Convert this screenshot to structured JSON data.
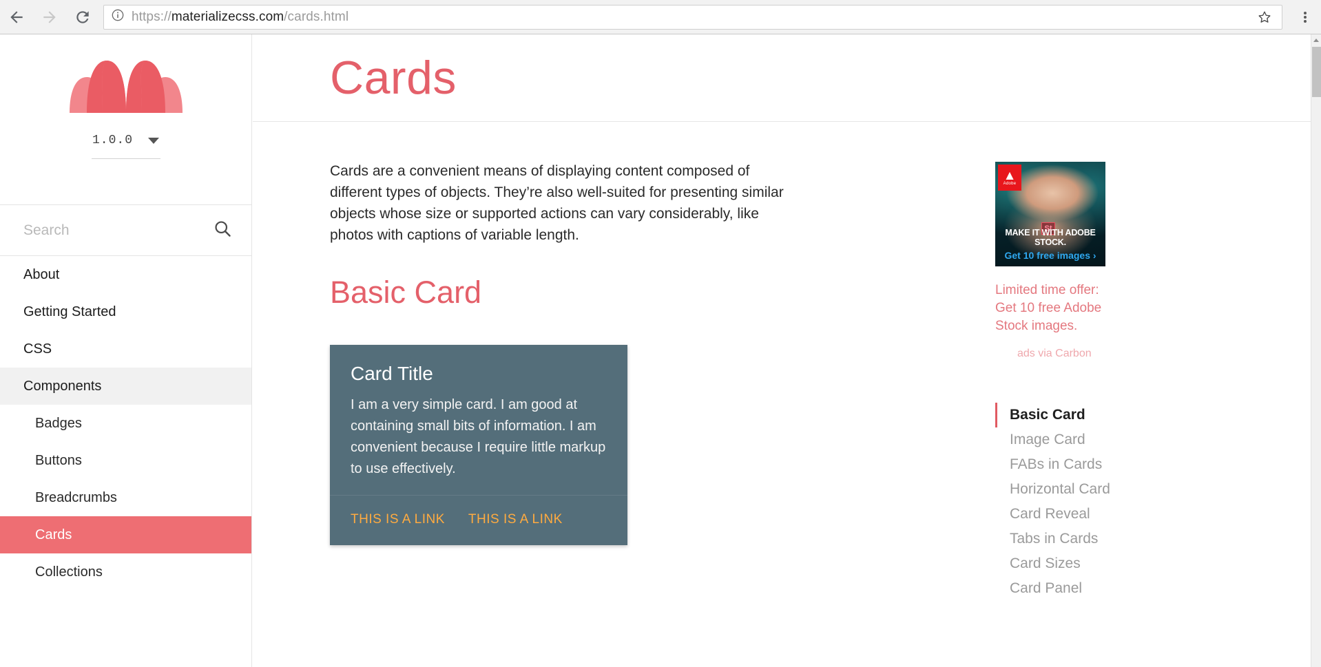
{
  "browser": {
    "back_label": "Back",
    "forward_label": "Forward",
    "reload_label": "Reload",
    "url_scheme": "https://",
    "url_host": "materializecss.com",
    "url_path": "/cards.html",
    "url_full": "https://materializecss.com/cards.html",
    "bookmark_label": "Bookmark this page",
    "menu_label": "Customize and control"
  },
  "sidebar": {
    "logo_name": "materialize-logo",
    "version": "1.0.0",
    "search": {
      "placeholder": "Search",
      "value": ""
    },
    "items": [
      {
        "label": "About",
        "level": "top",
        "state": "normal"
      },
      {
        "label": "Getting Started",
        "level": "top",
        "state": "normal"
      },
      {
        "label": "CSS",
        "level": "top",
        "state": "normal"
      },
      {
        "label": "Components",
        "level": "top",
        "state": "open"
      },
      {
        "label": "Badges",
        "level": "sub",
        "state": "normal"
      },
      {
        "label": "Buttons",
        "level": "sub",
        "state": "normal"
      },
      {
        "label": "Breadcrumbs",
        "level": "sub",
        "state": "normal"
      },
      {
        "label": "Cards",
        "level": "sub",
        "state": "active"
      },
      {
        "label": "Collections",
        "level": "sub",
        "state": "normal"
      }
    ]
  },
  "content": {
    "page_title": "Cards",
    "intro": "Cards are a convenient means of displaying content composed of different types of objects. They’re also well-suited for presenting similar objects whose size or supported actions can vary considerably, like photos with captions of variable length.",
    "section_title": "Basic Card",
    "card": {
      "title": "Card Title",
      "text": "I am a very simple card. I am good at containing small bits of information. I am convenient because I require little markup to use effectively.",
      "link1": "THIS IS A LINK",
      "link2": "THIS IS A LINK"
    }
  },
  "ad": {
    "brand": "Adobe",
    "brand_glyph": "▲",
    "product_badge": "St",
    "headline": "MAKE IT WITH ADOBE STOCK.",
    "cta": "Get 10 free images ›",
    "caption": "Limited time offer: Get 10 free Adobe Stock images.",
    "via": "ads via Carbon"
  },
  "toc": {
    "items": [
      {
        "label": "Basic Card",
        "active": true
      },
      {
        "label": "Image Card",
        "active": false
      },
      {
        "label": "FABs in Cards",
        "active": false
      },
      {
        "label": "Horizontal Card",
        "active": false
      },
      {
        "label": "Card Reveal",
        "active": false
      },
      {
        "label": "Tabs in Cards",
        "active": false
      },
      {
        "label": "Card Sizes",
        "active": false
      },
      {
        "label": "Card Panel",
        "active": false
      }
    ]
  },
  "colors": {
    "accent": "#ee6e73",
    "heading": "#e4606a",
    "card_bg": "#546e7a",
    "card_link": "#ffab40"
  }
}
